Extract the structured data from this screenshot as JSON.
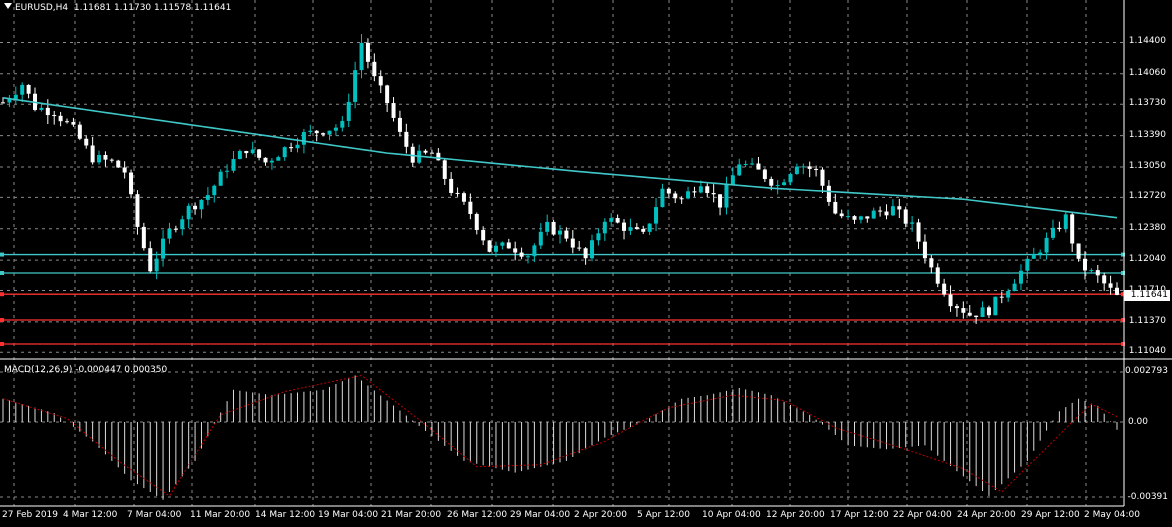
{
  "header": {
    "symbol": "EURUSD,H4",
    "ohlc": "1.11681 1.11730 1.11578 1.11641"
  },
  "indicator": {
    "label": "MACD(12,26,9) -0.000447 0.000350"
  },
  "price_axis": {
    "labels": [
      "1.14400",
      "1.14060",
      "1.13730",
      "1.13390",
      "1.13050",
      "1.12720",
      "1.12380",
      "1.12040",
      "1.11710",
      "1.11370",
      "1.11040"
    ],
    "current_price": "1.11641"
  },
  "macd_axis": {
    "labels": [
      "0.002793",
      "0.00",
      "-0.00391"
    ]
  },
  "time_axis": {
    "labels": [
      "27 Feb 2019",
      "4 Mar 12:00",
      "7 Mar 04:00",
      "11 Mar 20:00",
      "14 Mar 12:00",
      "19 Mar 04:00",
      "21 Mar 20:00",
      "26 Mar 12:00",
      "29 Mar 04:00",
      "2 Apr 20:00",
      "5 Apr 12:00",
      "10 Apr 04:00",
      "12 Apr 20:00",
      "17 Apr 12:00",
      "22 Apr 04:00",
      "24 Apr 20:00",
      "29 Apr 12:00",
      "2 May 04:00"
    ]
  },
  "horizontal_levels": {
    "cyan": [
      1.121,
      1.119
    ],
    "red": [
      1.1167,
      1.1139,
      1.1113
    ]
  },
  "colors": {
    "bull": "#00c0c0",
    "bear": "#ffffff",
    "ma": "#40c8c8",
    "grid": "#8a8a8a",
    "level_cyan": "#40c8c8",
    "level_red": "#ff3030",
    "signal": "#c00000"
  },
  "chart_data": [
    {
      "type": "candlestick",
      "title": "EURUSD,H4",
      "ylim": [
        1.11,
        1.146
      ],
      "close_path": [
        [
          0,
          1.1375
        ],
        [
          3,
          1.1395
        ],
        [
          5,
          1.137
        ],
        [
          8,
          1.1365
        ],
        [
          11,
          1.1345
        ],
        [
          14,
          1.1315
        ],
        [
          17,
          1.131
        ],
        [
          19,
          1.13
        ],
        [
          21,
          1.124
        ],
        [
          23,
          1.1195
        ],
        [
          26,
          1.1235
        ],
        [
          29,
          1.126
        ],
        [
          32,
          1.1275
        ],
        [
          35,
          1.1305
        ],
        [
          38,
          1.1325
        ],
        [
          41,
          1.131
        ],
        [
          44,
          1.1325
        ],
        [
          47,
          1.134
        ],
        [
          50,
          1.1345
        ],
        [
          53,
          1.135
        ],
        [
          56,
          1.144
        ],
        [
          58,
          1.14
        ],
        [
          60,
          1.1375
        ],
        [
          62,
          1.134
        ],
        [
          64,
          1.1315
        ],
        [
          67,
          1.132
        ],
        [
          70,
          1.128
        ],
        [
          73,
          1.1255
        ],
        [
          76,
          1.1215
        ],
        [
          79,
          1.122
        ],
        [
          82,
          1.121
        ],
        [
          85,
          1.124
        ],
        [
          88,
          1.123
        ],
        [
          91,
          1.1205
        ],
        [
          94,
          1.125
        ],
        [
          97,
          1.124
        ],
        [
          100,
          1.123
        ],
        [
          103,
          1.128
        ],
        [
          106,
          1.127
        ],
        [
          109,
          1.129
        ],
        [
          112,
          1.1265
        ],
        [
          115,
          1.131
        ],
        [
          118,
          1.13
        ],
        [
          121,
          1.1285
        ],
        [
          124,
          1.131
        ],
        [
          127,
          1.13
        ],
        [
          130,
          1.1255
        ],
        [
          133,
          1.1245
        ],
        [
          136,
          1.1255
        ],
        [
          139,
          1.126
        ],
        [
          142,
          1.124
        ],
        [
          145,
          1.1195
        ],
        [
          148,
          1.116
        ],
        [
          151,
          1.1145
        ],
        [
          154,
          1.115
        ],
        [
          157,
          1.1175
        ],
        [
          160,
          1.12
        ],
        [
          163,
          1.1225
        ],
        [
          166,
          1.125
        ],
        [
          168,
          1.12
        ],
        [
          171,
          1.1185
        ],
        [
          174,
          1.1164
        ]
      ],
      "moving_average": [
        [
          0,
          1.138
        ],
        [
          30,
          1.135
        ],
        [
          60,
          1.132
        ],
        [
          90,
          1.13
        ],
        [
          120,
          1.1282
        ],
        [
          150,
          1.127
        ],
        [
          174,
          1.125
        ]
      ]
    },
    {
      "type": "bar",
      "title": "MACD(12,26,9)",
      "ylim": [
        -0.00391,
        0.002793
      ],
      "macd_path": [
        [
          0,
          0.0013
        ],
        [
          8,
          0.0005
        ],
        [
          14,
          -0.001
        ],
        [
          20,
          -0.003
        ],
        [
          25,
          -0.004
        ],
        [
          30,
          -0.002
        ],
        [
          36,
          0.0018
        ],
        [
          42,
          0.0015
        ],
        [
          50,
          0.0018
        ],
        [
          55,
          0.0026
        ],
        [
          60,
          0.0012
        ],
        [
          65,
          -0.0002
        ],
        [
          72,
          -0.002
        ],
        [
          80,
          -0.0026
        ],
        [
          88,
          -0.002
        ],
        [
          94,
          -0.0008
        ],
        [
          100,
          0.0
        ],
        [
          106,
          0.0013
        ],
        [
          110,
          0.0015
        ],
        [
          115,
          0.0019
        ],
        [
          120,
          0.0015
        ],
        [
          126,
          0.0004
        ],
        [
          132,
          -0.0012
        ],
        [
          138,
          -0.0014
        ],
        [
          144,
          -0.0012
        ],
        [
          150,
          -0.0028
        ],
        [
          154,
          -0.0038
        ],
        [
          160,
          -0.002
        ],
        [
          165,
          0.0006
        ],
        [
          168,
          0.0013
        ],
        [
          171,
          0.0009
        ],
        [
          174,
          -0.0004
        ]
      ],
      "signal_path": [
        [
          0,
          0.0013
        ],
        [
          10,
          0.0002
        ],
        [
          18,
          -0.002
        ],
        [
          26,
          -0.0038
        ],
        [
          34,
          0.0004
        ],
        [
          44,
          0.0017
        ],
        [
          56,
          0.0026
        ],
        [
          64,
          0.0004
        ],
        [
          74,
          -0.0023
        ],
        [
          84,
          -0.0022
        ],
        [
          94,
          -0.001
        ],
        [
          104,
          0.0008
        ],
        [
          114,
          0.0015
        ],
        [
          122,
          0.0012
        ],
        [
          130,
          -0.0003
        ],
        [
          140,
          -0.0013
        ],
        [
          150,
          -0.0024
        ],
        [
          156,
          -0.0036
        ],
        [
          164,
          -0.001
        ],
        [
          170,
          0.001
        ],
        [
          174,
          0.0003
        ]
      ]
    }
  ]
}
